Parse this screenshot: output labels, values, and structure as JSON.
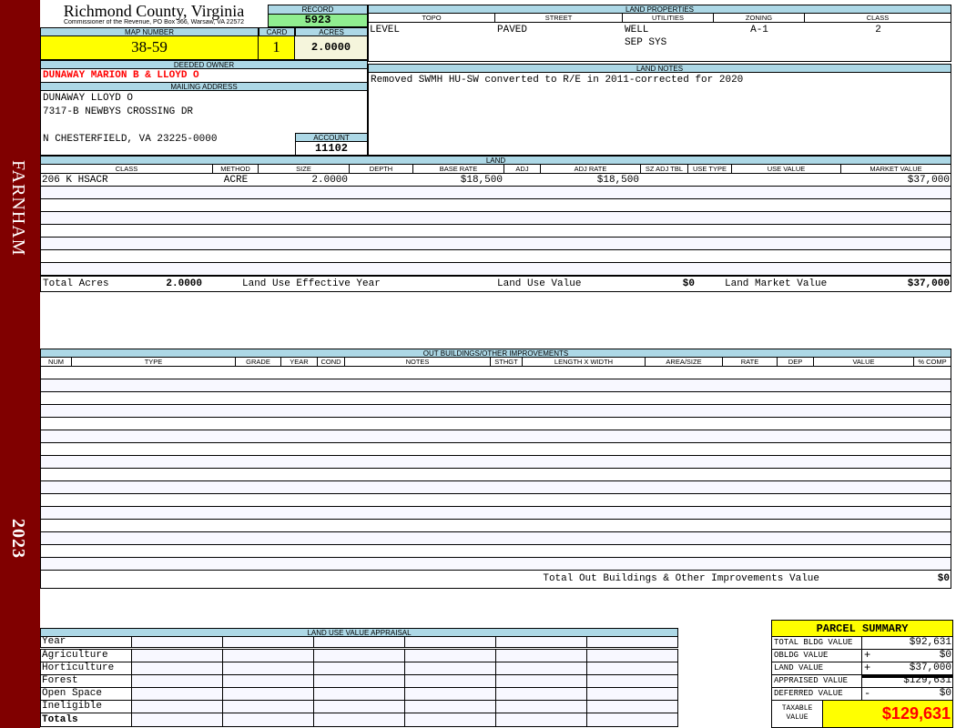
{
  "sidebar": {
    "district": "FARNHAM",
    "year": "2023"
  },
  "header": {
    "county": "Richmond County, Virginia",
    "office": "Commissioner of the Revenue, PO Box 366, Warsaw, VA 22572"
  },
  "record": {
    "label": "RECORD",
    "value": "5923"
  },
  "map": {
    "label": "MAP NUMBER",
    "value": "38-59"
  },
  "card": {
    "label": "CARD",
    "value": "1"
  },
  "acres": {
    "label": "ACRES",
    "value": "2.0000"
  },
  "owner": {
    "label": "DEEDED OWNER",
    "value": "DUNAWAY MARION B & LLOYD O"
  },
  "mailing": {
    "label": "MAILING ADDRESS",
    "lines": [
      "DUNAWAY LLOYD O",
      "7317-B NEWBYS CROSSING DR",
      "",
      "N CHESTERFIELD, VA 23225-0000"
    ]
  },
  "account": {
    "label": "ACCOUNT",
    "value": "11102"
  },
  "land_properties": {
    "label": "LAND PROPERTIES",
    "columns": [
      "TOPO",
      "STREET",
      "UTILITIES",
      "ZONING",
      "CLASS"
    ],
    "values": [
      "LEVEL",
      "PAVED",
      "WELL\nSEP SYS",
      "A-1",
      "2"
    ]
  },
  "land_notes": {
    "label": "LAND NOTES",
    "text": "Removed SWMH HU-SW converted to R/E in 2011-corrected for 2020"
  },
  "land": {
    "label": "LAND",
    "columns": [
      "CLASS",
      "METHOD",
      "SIZE",
      "DEPTH",
      "BASE RATE",
      "ADJ",
      "ADJ RATE",
      "SZ ADJ TBL",
      "USE TYPE",
      "USE VALUE",
      "MARKET VALUE"
    ],
    "rows": [
      [
        "206 K HSACR",
        "ACRE",
        "2.0000",
        "",
        "$18,500",
        "",
        "$18,500",
        "",
        "",
        "",
        "$37,000"
      ]
    ],
    "totals": {
      "total_acres_label": "Total Acres",
      "total_acres": "2.0000",
      "effective_year_label": "Land Use Effective Year",
      "effective_year": "",
      "use_value_label": "Land Use Value",
      "use_value": "$0",
      "market_value_label": "Land Market Value",
      "market_value": "$37,000"
    }
  },
  "outbuildings": {
    "label": "OUT BUILDINGS/OTHER IMPROVEMENTS",
    "columns": [
      "NUM",
      "TYPE",
      "GRADE",
      "YEAR",
      "COND",
      "NOTES",
      "STHGT",
      "LENGTH X WIDTH",
      "AREA/SIZE",
      "RATE",
      "DEP",
      "VALUE",
      "% COMP"
    ],
    "rows": [],
    "total_label": "Total Out Buildings & Other Improvements Value",
    "total_value": "$0"
  },
  "land_use_appraisal": {
    "label": "LAND USE VALUE APPRAISAL",
    "year_label": "Year",
    "rows": [
      "Agriculture",
      "Horticulture",
      "Forest",
      "Open Space",
      "Ineligible"
    ],
    "totals_label": "Totals"
  },
  "parcel_summary": {
    "title": "PARCEL SUMMARY",
    "rows": [
      {
        "label": "TOTAL BLDG VALUE",
        "sign": "",
        "value": "$92,631"
      },
      {
        "label": "OBLDG VALUE",
        "sign": "+",
        "value": "$0"
      },
      {
        "label": "LAND VALUE",
        "sign": "+",
        "value": "$37,000"
      },
      {
        "label": "APPRAISED VALUE",
        "sign": "",
        "value": "$129,631"
      },
      {
        "label": "DEFERRED VALUE",
        "sign": "-",
        "value": "$0"
      }
    ],
    "taxable_label": "TAXABLE VALUE",
    "taxable_value": "$129,631"
  },
  "colors": {
    "sidebar": "#800000",
    "header_bg": "#add8e6",
    "highlight": "#ffff00",
    "record_bg": "#90ee90",
    "owner_text": "#ff0000",
    "taxable_text": "#ff0000"
  }
}
